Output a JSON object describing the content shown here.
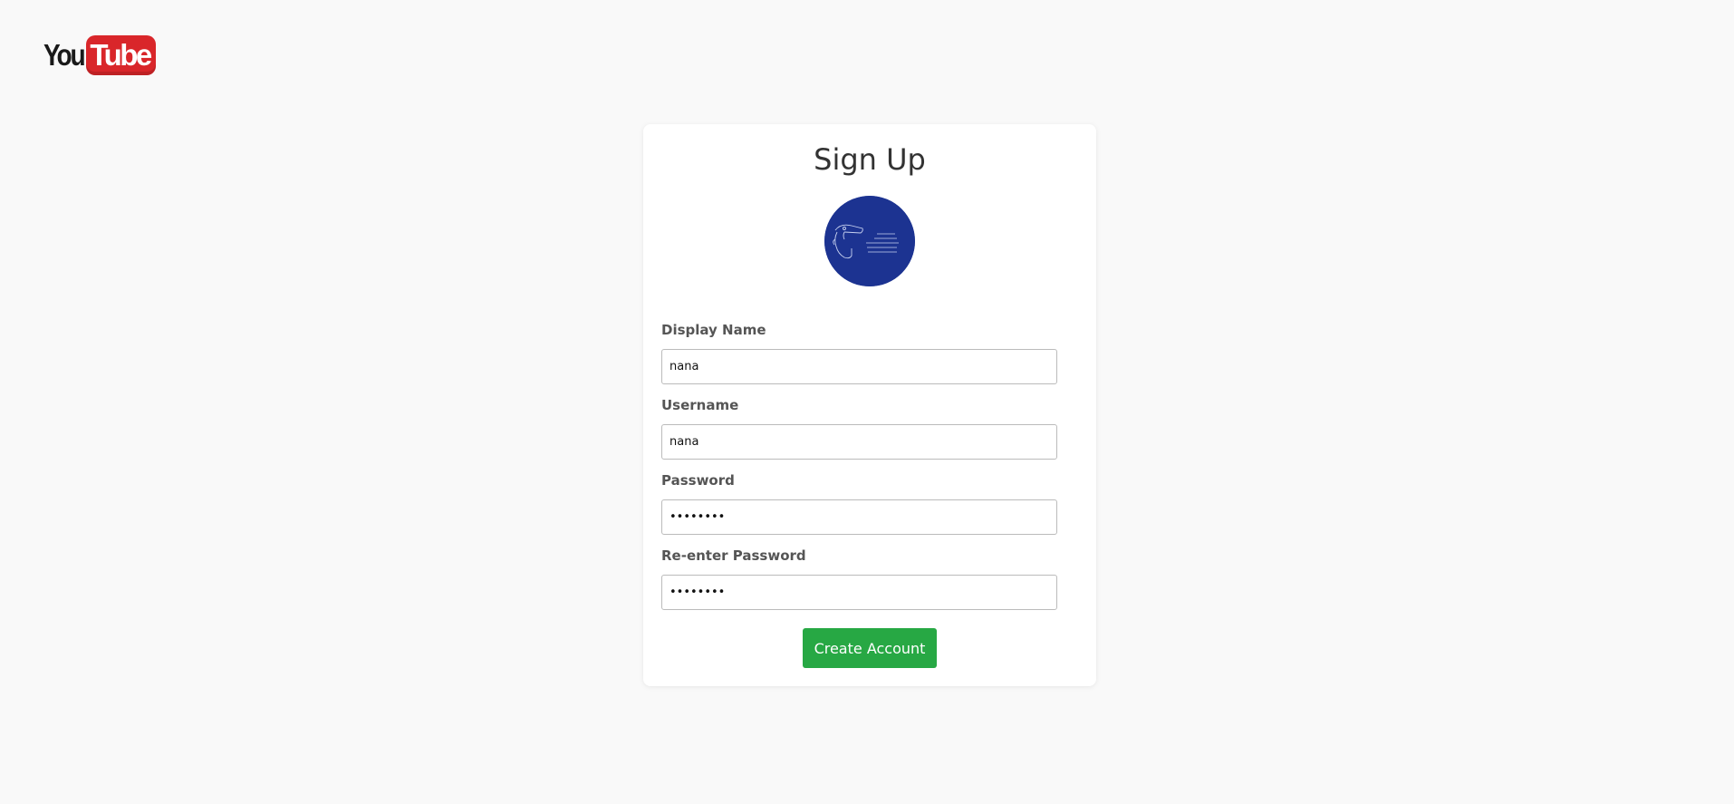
{
  "logo": {
    "part1": "You",
    "part2": "Tube"
  },
  "form": {
    "title": "Sign Up",
    "fields": [
      {
        "label": "Display Name",
        "value": "nana",
        "type": "text"
      },
      {
        "label": "Username",
        "value": "nana",
        "type": "text"
      },
      {
        "label": "Password",
        "value": "nananana",
        "type": "password"
      },
      {
        "label": "Re-enter Password",
        "value": "nananana",
        "type": "password"
      }
    ],
    "submit_label": "Create Account"
  },
  "colors": {
    "page_bg": "#f9f9f9",
    "card_bg": "#ffffff",
    "submit_bg": "#27a844",
    "avatar_bg": "#1c3391",
    "logo_red": "#d9262a"
  }
}
